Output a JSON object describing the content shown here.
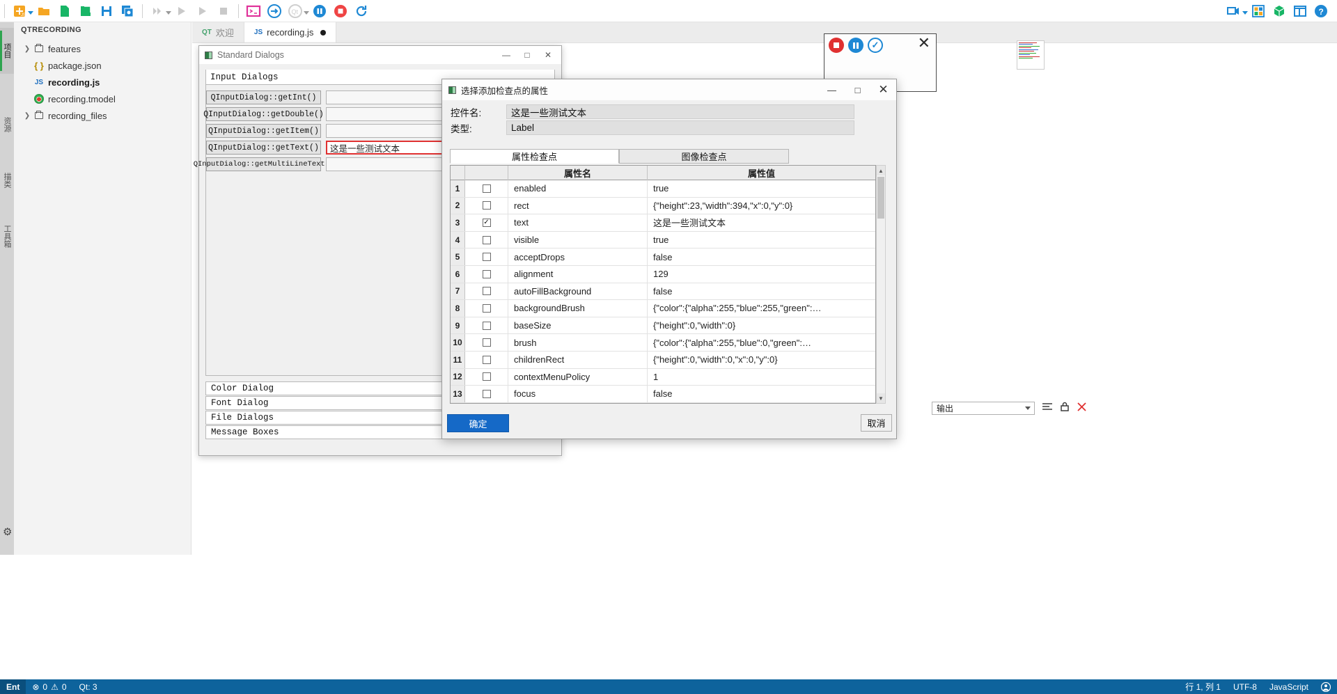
{
  "toolbar": {
    "left_icons": [
      {
        "name": "new-script-icon",
        "label": "新建脚本"
      },
      {
        "name": "open-folder-icon",
        "label": "打开文件夹"
      },
      {
        "name": "new-file-icon",
        "label": "新建文件"
      },
      {
        "name": "open-file-icon",
        "label": "打开文件"
      },
      {
        "name": "save-icon",
        "label": "保存"
      },
      {
        "name": "save-all-icon",
        "label": "全部保存"
      },
      {
        "name": "run-all-icon",
        "label": "运行全部"
      },
      {
        "name": "run-debug-icon",
        "label": "调试运行"
      },
      {
        "name": "run-js-icon",
        "label": "运行 JS"
      },
      {
        "name": "stop-icon",
        "label": "停止"
      },
      {
        "name": "terminal-icon",
        "label": "终端"
      },
      {
        "name": "attach-icon",
        "label": "附加"
      },
      {
        "name": "qt-icon",
        "label": "Qt"
      },
      {
        "name": "pause-record-icon",
        "label": "暂停录制"
      },
      {
        "name": "stop-record-icon",
        "label": "停止录制"
      },
      {
        "name": "refresh-icon",
        "label": "刷新"
      }
    ],
    "right_icons": [
      {
        "name": "record-camera-icon",
        "label": "录制"
      },
      {
        "name": "layout-grid-icon",
        "label": "布局"
      },
      {
        "name": "package-icon",
        "label": "打包"
      },
      {
        "name": "panel-toggle-icon",
        "label": "面板"
      },
      {
        "name": "help-icon",
        "label": "帮助"
      }
    ]
  },
  "activity_bar": {
    "items": [
      {
        "label": "项目",
        "active": true
      },
      {
        "label": "资源",
        "active": false
      },
      {
        "label": "描类",
        "active": false
      },
      {
        "label": "工具箱",
        "active": false
      }
    ]
  },
  "sidebar": {
    "header": "QTRECORDING",
    "tree": [
      {
        "label": "features",
        "icon": "folder-icon",
        "twisty": "›",
        "bold": false
      },
      {
        "label": "package.json",
        "icon": "json-icon",
        "twisty": "",
        "bold": false
      },
      {
        "label": "recording.js",
        "icon": "js-icon",
        "twisty": "",
        "bold": true
      },
      {
        "label": "recording.tmodel",
        "icon": "tmodel-icon",
        "twisty": "",
        "bold": false
      },
      {
        "label": "recording_files",
        "icon": "folder-icon",
        "twisty": "›",
        "bold": false
      }
    ]
  },
  "editor": {
    "tabs": [
      {
        "label": "欢迎",
        "icon": "qt-welcome-icon",
        "active": false,
        "dirty": false
      },
      {
        "label": "recording.js",
        "icon": "js-icon",
        "active": true,
        "dirty": true
      }
    ]
  },
  "standard_dialogs": {
    "title": "Standard Dialogs",
    "window_buttons": {
      "minimize": "—",
      "maximize": "□",
      "close": "✕"
    },
    "group_title": "Input Dialogs",
    "rows": [
      {
        "button": "QInputDialog::getInt()",
        "value": "",
        "flagged": false
      },
      {
        "button": "QInputDialog::getDouble()",
        "value": "",
        "flagged": false
      },
      {
        "button": "QInputDialog::getItem()",
        "value": "",
        "flagged": false
      },
      {
        "button": "QInputDialog::getText()",
        "value": "这是一些测试文本",
        "flagged": true
      },
      {
        "button": "QInputDialog::getMultiLineText()",
        "value": "",
        "flagged": false
      }
    ],
    "sections": [
      "Color Dialog",
      "Font Dialog",
      "File Dialogs",
      "Message Boxes"
    ]
  },
  "record_overlay": {
    "buttons": [
      {
        "name": "stop-record-button",
        "label": "停止"
      },
      {
        "name": "pause-record-button",
        "label": "暂停"
      },
      {
        "name": "confirm-record-button",
        "label": "确认"
      }
    ],
    "close_label": "✕"
  },
  "property_dialog": {
    "title": "选择添加检查点的属性",
    "window_buttons": {
      "minimize": "—",
      "maximize": "□",
      "close": "✕"
    },
    "fields": [
      {
        "label": "控件名:",
        "value": "这是一些测试文本"
      },
      {
        "label": "类型:",
        "value": "Label"
      }
    ],
    "tabs": [
      {
        "label": "属性检查点",
        "active": true
      },
      {
        "label": "图像检查点",
        "active": false
      }
    ],
    "table": {
      "headers": [
        "",
        "",
        "属性名",
        "属性值"
      ],
      "rows": [
        {
          "num": "1",
          "checked": false,
          "name": "enabled",
          "value": "true"
        },
        {
          "num": "2",
          "checked": false,
          "name": "rect",
          "value": "{\"height\":23,\"width\":394,\"x\":0,\"y\":0}"
        },
        {
          "num": "3",
          "checked": true,
          "name": "text",
          "value": "这是一些测试文本"
        },
        {
          "num": "4",
          "checked": false,
          "name": "visible",
          "value": "true"
        },
        {
          "num": "5",
          "checked": false,
          "name": "acceptDrops",
          "value": "false"
        },
        {
          "num": "6",
          "checked": false,
          "name": "alignment",
          "value": "129"
        },
        {
          "num": "7",
          "checked": false,
          "name": "autoFillBackground",
          "value": "false"
        },
        {
          "num": "8",
          "checked": false,
          "name": "backgroundBrush",
          "value": "{\"color\":{\"alpha\":255,\"blue\":255,\"green\":…"
        },
        {
          "num": "9",
          "checked": false,
          "name": "baseSize",
          "value": "{\"height\":0,\"width\":0}"
        },
        {
          "num": "10",
          "checked": false,
          "name": "brush",
          "value": "{\"color\":{\"alpha\":255,\"blue\":0,\"green\":…"
        },
        {
          "num": "11",
          "checked": false,
          "name": "childrenRect",
          "value": "{\"height\":0,\"width\":0,\"x\":0,\"y\":0}"
        },
        {
          "num": "12",
          "checked": false,
          "name": "contextMenuPolicy",
          "value": "1"
        },
        {
          "num": "13",
          "checked": false,
          "name": "focus",
          "value": "false"
        }
      ]
    },
    "ok_label": "确定",
    "cancel_label": "取消"
  },
  "output_panel": {
    "selected": "输出",
    "clear_icon": "clear-output-icon",
    "lock_icon": "lock-icon",
    "close_icon": "close-panel-icon"
  },
  "status_bar": {
    "ent": "Ent",
    "errors": "0",
    "warnings": "0",
    "qt": "Qt: 3",
    "position": "行 1, 列 1",
    "encoding": "UTF-8",
    "language": "JavaScript",
    "account_icon": "account-icon"
  },
  "colors": {
    "accent": "#0e639c",
    "record_red": "#e03131",
    "record_blue": "#1e88d4",
    "ok_blue": "#1569c7",
    "flag_red": "#e03131"
  }
}
